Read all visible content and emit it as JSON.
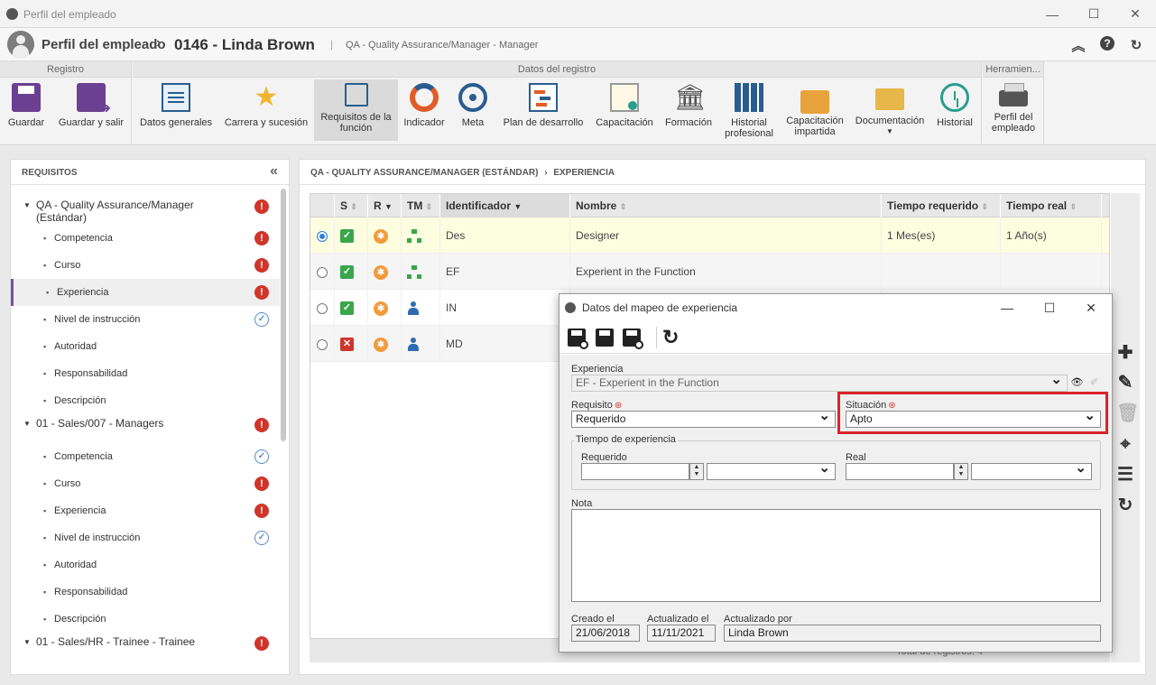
{
  "window": {
    "title": "Perfil del empleado"
  },
  "header": {
    "module": "Perfil del empleado",
    "record": "0146 - Linda Brown",
    "subtitle": "QA - Quality Assurance/Manager - Manager"
  },
  "ribbon": {
    "groups": {
      "registro": "Registro",
      "datos": "Datos del registro",
      "herramientas": "Herramien..."
    },
    "buttons": {
      "guardar": "Guardar",
      "guardar_salir": "Guardar y salir",
      "datos_generales": "Datos generales",
      "carrera": "Carrera y sucesión",
      "requisitos_1": "Requisitos de la",
      "requisitos_2": "función",
      "indicador": "Indicador",
      "meta": "Meta",
      "plan": "Plan de desarrollo",
      "capacitacion": "Capacitación",
      "formacion": "Formación",
      "historial_prof_1": "Historial",
      "historial_prof_2": "profesional",
      "cap_impartida_1": "Capacitación",
      "cap_impartida_2": "impartida",
      "documentacion": "Documentación",
      "historial": "Historial",
      "perfil_1": "Perfil del",
      "perfil_2": "empleado"
    }
  },
  "left": {
    "title": "REQUISITOS",
    "groups": [
      {
        "label": "QA - Quality Assurance/Manager (Estándar)",
        "status": "error",
        "items": [
          {
            "label": "Competencia",
            "status": "error"
          },
          {
            "label": "Curso",
            "status": "error"
          },
          {
            "label": "Experiencia",
            "status": "error"
          },
          {
            "label": "Nivel de instrucción",
            "status": "ok"
          },
          {
            "label": "Autoridad",
            "status": ""
          },
          {
            "label": "Responsabilidad",
            "status": ""
          },
          {
            "label": "Descripción",
            "status": ""
          }
        ]
      },
      {
        "label": "01 - Sales/007 - Managers",
        "status": "error",
        "items": [
          {
            "label": "Competencia",
            "status": "ok"
          },
          {
            "label": "Curso",
            "status": "error"
          },
          {
            "label": "Experiencia",
            "status": "error"
          },
          {
            "label": "Nivel de instrucción",
            "status": "ok"
          },
          {
            "label": "Autoridad",
            "status": ""
          },
          {
            "label": "Responsabilidad",
            "status": ""
          },
          {
            "label": "Descripción",
            "status": ""
          }
        ]
      },
      {
        "label": "01 - Sales/HR - Trainee - Trainee",
        "status": "error",
        "items": []
      }
    ]
  },
  "right": {
    "breadcrumb_1": "QA - QUALITY ASSURANCE/MANAGER (ESTÁNDAR)",
    "breadcrumb_2": "EXPERIENCIA",
    "columns": {
      "s": "S",
      "r": "R",
      "tm": "TM",
      "id": "Identificador",
      "nombre": "Nombre",
      "treq": "Tiempo requerido",
      "treal": "Tiempo real"
    },
    "rows": [
      {
        "id": "Des",
        "nombre": "Designer",
        "treq": "1 Mes(es)",
        "treal": "1 Año(s)"
      },
      {
        "id": "EF",
        "nombre": "Experient in the Function",
        "treq": "",
        "treal": ""
      },
      {
        "id": "IN",
        "nombre": "",
        "treq": "",
        "treal": ""
      },
      {
        "id": "MD",
        "nombre": "",
        "treq": "",
        "treal": ""
      }
    ],
    "total": "Total de registros: 4"
  },
  "dialog": {
    "title": "Datos del mapeo de experiencia",
    "experiencia_label": "Experiencia",
    "experiencia_value": "EF - Experient in the Function",
    "requisito_label": "Requisito",
    "requisito_value": "Requerido",
    "situacion_label": "Situación",
    "situacion_value": "Apto",
    "tiempo_legend": "Tiempo de experiencia",
    "requerido_label": "Requerido",
    "real_label": "Real",
    "nota_label": "Nota",
    "creado_label": "Creado el",
    "creado_value": "21/06/2018",
    "actualizado_label": "Actualizado el",
    "actualizado_value": "11/11/2021",
    "actualizado_por_label": "Actualizado por",
    "actualizado_por_value": "Linda Brown"
  },
  "colors": {
    "accent": "#7a4ea8",
    "error": "#d0352a",
    "ok": "#5a8bc4",
    "highlight": "#d9242b",
    "selected_row": "#fdfde0"
  }
}
